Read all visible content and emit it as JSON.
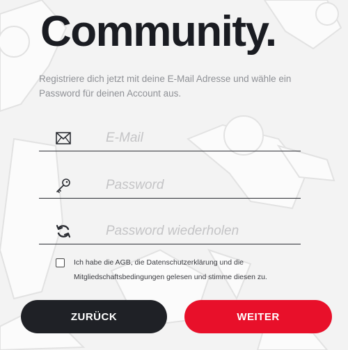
{
  "header": {
    "title": "Community.",
    "intro": "Registriere dich jetzt mit deine E-Mail Adresse und wähle ein Password für deinen Account aus."
  },
  "form": {
    "email": {
      "placeholder": "E-Mail",
      "value": "",
      "icon": "envelope-icon"
    },
    "password": {
      "placeholder": "Password",
      "value": "",
      "icon": "key-icon"
    },
    "password_repeat": {
      "placeholder": "Password wiederholen",
      "value": "",
      "icon": "refresh-icon"
    },
    "consent": {
      "checked": false,
      "text": "Ich habe die AGB, die Datenschutzerklärung und die Mitgliedschaftsbedingungen gelesen und stimme diesen zu."
    }
  },
  "actions": {
    "back_label": "ZURÜCK",
    "next_label": "WEITER"
  },
  "colors": {
    "background": "#f3f3f3",
    "primary_dark": "#1f2126",
    "accent_red": "#e8102a",
    "muted_text": "#8e9095"
  }
}
